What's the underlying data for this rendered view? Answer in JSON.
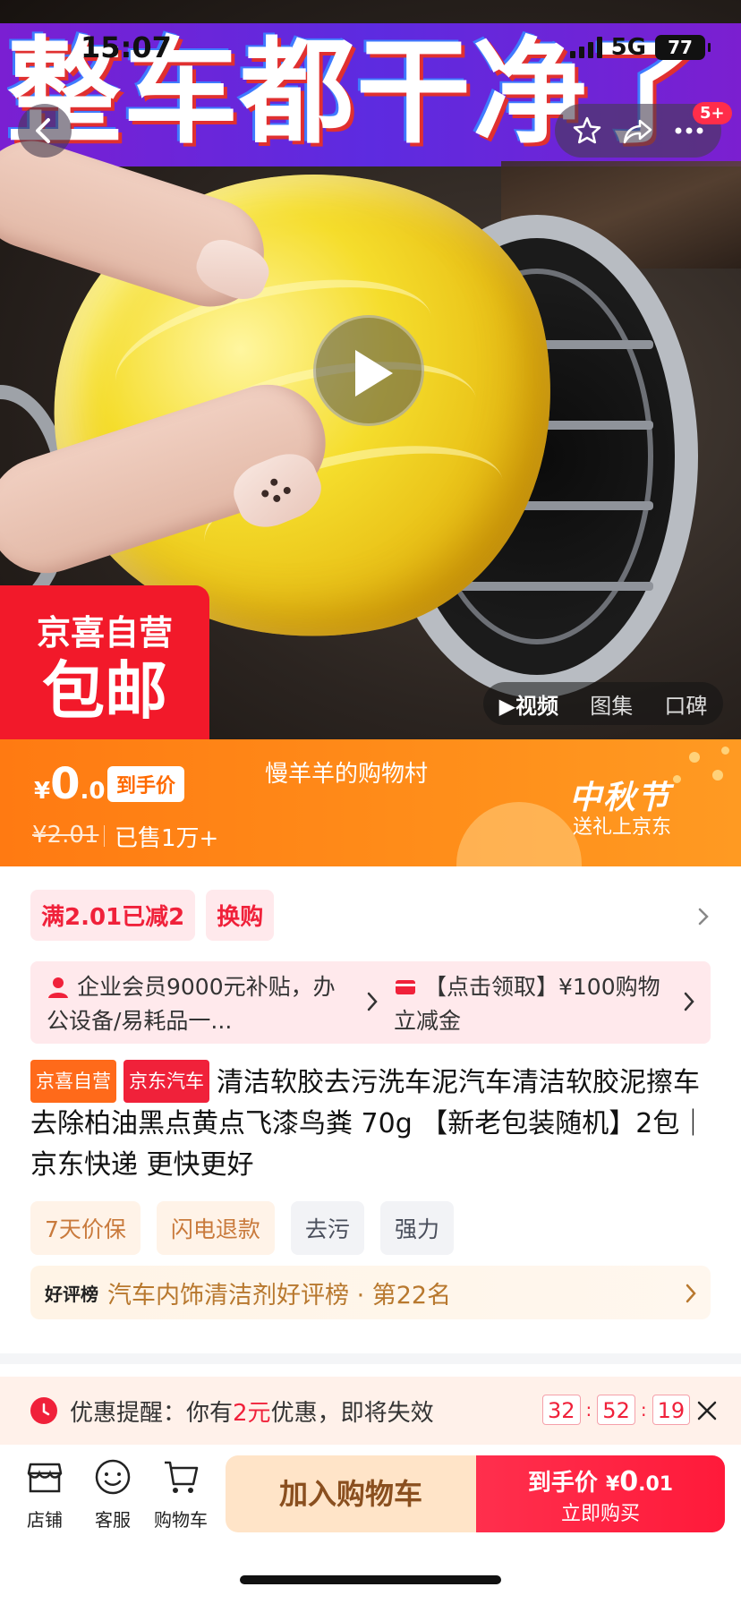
{
  "status_bar": {
    "time": "15:07",
    "network": "5G",
    "battery": "77"
  },
  "hero": {
    "headline": "整车都干净了",
    "badge_count": "5+",
    "jx_badge": {
      "line1": "京喜自营",
      "line2": "包邮"
    },
    "media_tabs": [
      "▶视频",
      "图集",
      "口碑"
    ]
  },
  "price": {
    "currency": "¥",
    "integer": "0",
    "decimal": ".01",
    "tag": "到手价",
    "original": "¥2.01",
    "sold": "已售1万+",
    "shop_name": "慢羊羊的购物村",
    "festival": "中秋节",
    "festival_sub": "送礼上京东"
  },
  "promos": [
    "满2.01已减2",
    "换购"
  ],
  "coupons": [
    {
      "text": "企业会员9000元补贴，办公设备/易耗品一..."
    },
    {
      "text": "【点击领取】¥100购物立减金"
    }
  ],
  "product": {
    "tag_jx": "京喜自营",
    "tag_car": "京东汽车",
    "title": "清洁软胶去污洗车泥汽车清洁软胶泥擦车去除柏油黑点黄点飞漆鸟粪 70g 【新老包装随机】2包｜京东快递 更快更好"
  },
  "services": [
    {
      "label": "7天价保",
      "style": "warm"
    },
    {
      "label": "闪电退款",
      "style": "warm"
    },
    {
      "label": "去污",
      "style": "cool"
    },
    {
      "label": "强力",
      "style": "cool"
    }
  ],
  "ranking": {
    "label": "好评榜",
    "text": "汽车内饰清洁剂好评榜 · 第22名"
  },
  "reminder": {
    "prefix": "优惠提醒：你有",
    "amount": "2元",
    "suffix": "优惠，即将失效",
    "countdown": [
      "32",
      "52",
      "19"
    ]
  },
  "bottom_bar": {
    "icons": [
      {
        "label": "店铺",
        "icon": "store-icon"
      },
      {
        "label": "客服",
        "icon": "customer-service-icon"
      },
      {
        "label": "购物车",
        "icon": "cart-icon"
      }
    ],
    "add_cart": "加入购物车",
    "buy_line1": "到手价",
    "buy_currency": "¥",
    "buy_price_int": "0",
    "buy_price_dec": ".01",
    "buy_line2": "立即购买"
  },
  "colors": {
    "brand_red": "#f0213a",
    "price_orange": "#ff8e1a",
    "headline_bg": "#6a22d8"
  }
}
